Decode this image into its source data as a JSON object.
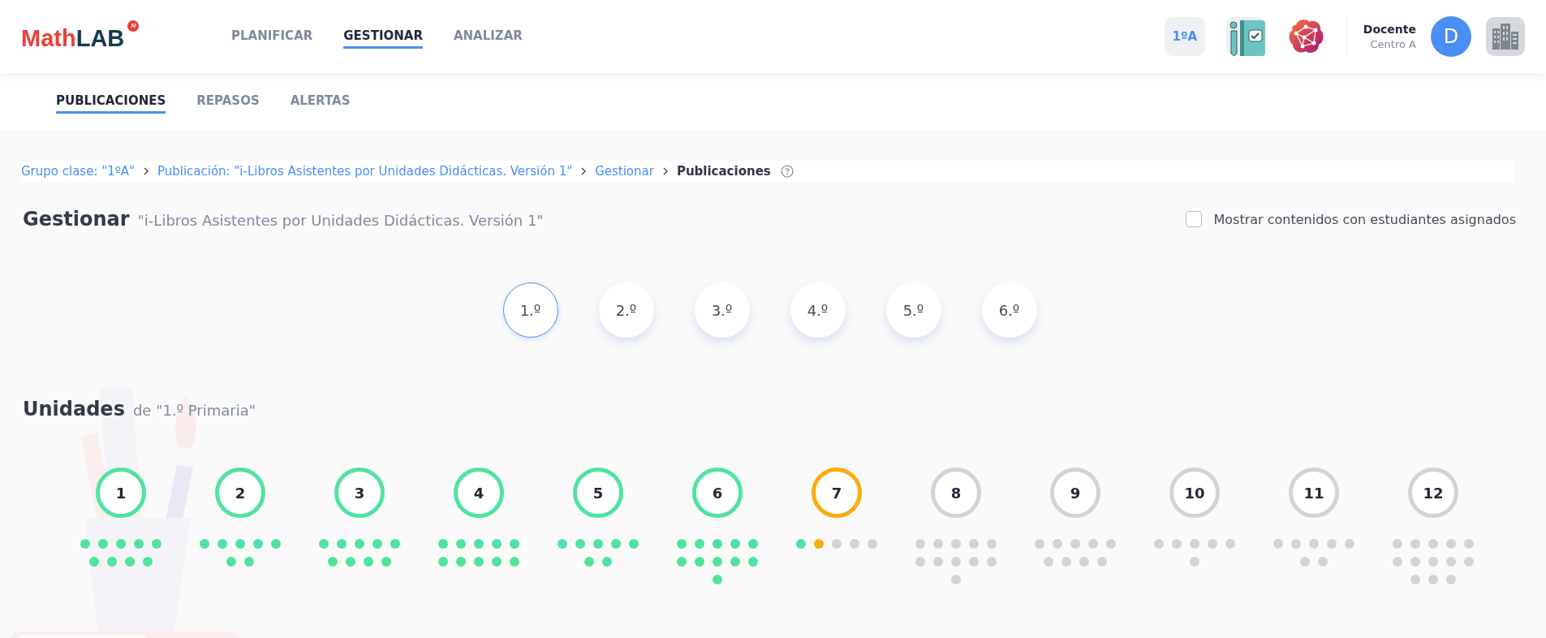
{
  "header": {
    "logo": {
      "part_1": "Math",
      "part_2": "LAB",
      "badge": "N"
    },
    "nav": [
      {
        "label": "PLANIFICAR",
        "selected": false
      },
      {
        "label": "GESTIONAR",
        "selected": true
      },
      {
        "label": "ANALIZAR",
        "selected": false
      }
    ],
    "group_badge": "1ºA",
    "user": {
      "name": "Docente",
      "center": "Centro A",
      "initial": "D"
    }
  },
  "subnav": [
    {
      "label": "PUBLICACIONES",
      "selected": true
    },
    {
      "label": "REPASOS",
      "selected": false
    },
    {
      "label": "ALERTAS",
      "selected": false
    }
  ],
  "breadcrumb": [
    {
      "label": "Grupo clase: \"1ºA\"",
      "current": false
    },
    {
      "label": "Publicación: \"i-Libros Asistentes por Unidades Didácticas. Versión 1\"",
      "current": false
    },
    {
      "label": "Gestionar",
      "current": false
    },
    {
      "label": "Publicaciones",
      "current": true
    }
  ],
  "title": {
    "heading": "Gestionar",
    "subtitle": "\"i-Libros Asistentes por Unidades Didácticas. Versión 1\""
  },
  "filter": {
    "label": "Mostrar contenidos con estudiantes asignados",
    "checked": false
  },
  "grades": [
    {
      "label": "1.º",
      "selected": true
    },
    {
      "label": "2.º",
      "selected": false
    },
    {
      "label": "3.º",
      "selected": false
    },
    {
      "label": "4.º",
      "selected": false
    },
    {
      "label": "5.º",
      "selected": false
    },
    {
      "label": "6.º",
      "selected": false
    }
  ],
  "units_title": {
    "heading": "Unidades",
    "subtitle": "de \"1.º Primaria\""
  },
  "units": [
    {
      "number": "1",
      "done": true,
      "current": false,
      "dots": [
        {
          "done": true,
          "current": false
        },
        {
          "done": true,
          "current": false
        },
        {
          "done": true,
          "current": false
        },
        {
          "done": true,
          "current": false
        },
        {
          "done": true,
          "current": false
        },
        {
          "done": true,
          "current": false
        },
        {
          "done": true,
          "current": false
        },
        {
          "done": true,
          "current": false
        },
        {
          "done": true,
          "current": false
        }
      ]
    },
    {
      "number": "2",
      "done": true,
      "current": false,
      "dots": [
        {
          "done": true,
          "current": false
        },
        {
          "done": true,
          "current": false
        },
        {
          "done": true,
          "current": false
        },
        {
          "done": true,
          "current": false
        },
        {
          "done": true,
          "current": false
        },
        {
          "done": true,
          "current": false
        },
        {
          "done": true,
          "current": false
        }
      ]
    },
    {
      "number": "3",
      "done": true,
      "current": false,
      "dots": [
        {
          "done": true,
          "current": false
        },
        {
          "done": true,
          "current": false
        },
        {
          "done": true,
          "current": false
        },
        {
          "done": true,
          "current": false
        },
        {
          "done": true,
          "current": false
        },
        {
          "done": true,
          "current": false
        },
        {
          "done": true,
          "current": false
        },
        {
          "done": true,
          "current": false
        },
        {
          "done": true,
          "current": false
        }
      ]
    },
    {
      "number": "4",
      "done": true,
      "current": false,
      "dots": [
        {
          "done": true,
          "current": false
        },
        {
          "done": true,
          "current": false
        },
        {
          "done": true,
          "current": false
        },
        {
          "done": true,
          "current": false
        },
        {
          "done": true,
          "current": false
        },
        {
          "done": true,
          "current": false
        },
        {
          "done": true,
          "current": false
        },
        {
          "done": true,
          "current": false
        },
        {
          "done": true,
          "current": false
        },
        {
          "done": true,
          "current": false
        }
      ]
    },
    {
      "number": "5",
      "done": true,
      "current": false,
      "dots": [
        {
          "done": true,
          "current": false
        },
        {
          "done": true,
          "current": false
        },
        {
          "done": true,
          "current": false
        },
        {
          "done": true,
          "current": false
        },
        {
          "done": true,
          "current": false
        },
        {
          "done": true,
          "current": false
        },
        {
          "done": true,
          "current": false
        }
      ]
    },
    {
      "number": "6",
      "done": true,
      "current": false,
      "dots": [
        {
          "done": true,
          "current": false
        },
        {
          "done": true,
          "current": false
        },
        {
          "done": true,
          "current": false
        },
        {
          "done": true,
          "current": false
        },
        {
          "done": true,
          "current": false
        },
        {
          "done": true,
          "current": false
        },
        {
          "done": true,
          "current": false
        },
        {
          "done": true,
          "current": false
        },
        {
          "done": true,
          "current": false
        },
        {
          "done": true,
          "current": false
        },
        {
          "done": true,
          "current": false
        }
      ]
    },
    {
      "number": "7",
      "done": false,
      "current": true,
      "dots": [
        {
          "done": true,
          "current": false
        },
        {
          "done": false,
          "current": true
        },
        {
          "done": false,
          "current": false
        },
        {
          "done": false,
          "current": false
        },
        {
          "done": false,
          "current": false
        }
      ]
    },
    {
      "number": "8",
      "done": false,
      "current": false,
      "dots": [
        {
          "done": false,
          "current": false
        },
        {
          "done": false,
          "current": false
        },
        {
          "done": false,
          "current": false
        },
        {
          "done": false,
          "current": false
        },
        {
          "done": false,
          "current": false
        },
        {
          "done": false,
          "current": false
        },
        {
          "done": false,
          "current": false
        },
        {
          "done": false,
          "current": false
        },
        {
          "done": false,
          "current": false
        },
        {
          "done": false,
          "current": false
        },
        {
          "done": false,
          "current": false
        }
      ]
    },
    {
      "number": "9",
      "done": false,
      "current": false,
      "dots": [
        {
          "done": false,
          "current": false
        },
        {
          "done": false,
          "current": false
        },
        {
          "done": false,
          "current": false
        },
        {
          "done": false,
          "current": false
        },
        {
          "done": false,
          "current": false
        },
        {
          "done": false,
          "current": false
        },
        {
          "done": false,
          "current": false
        },
        {
          "done": false,
          "current": false
        },
        {
          "done": false,
          "current": false
        }
      ]
    },
    {
      "number": "10",
      "done": false,
      "current": false,
      "dots": [
        {
          "done": false,
          "current": false
        },
        {
          "done": false,
          "current": false
        },
        {
          "done": false,
          "current": false
        },
        {
          "done": false,
          "current": false
        },
        {
          "done": false,
          "current": false
        },
        {
          "done": false,
          "current": false
        }
      ]
    },
    {
      "number": "11",
      "done": false,
      "current": false,
      "dots": [
        {
          "done": false,
          "current": false
        },
        {
          "done": false,
          "current": false
        },
        {
          "done": false,
          "current": false
        },
        {
          "done": false,
          "current": false
        },
        {
          "done": false,
          "current": false
        },
        {
          "done": false,
          "current": false
        },
        {
          "done": false,
          "current": false
        }
      ]
    },
    {
      "number": "12",
      "done": false,
      "current": false,
      "dots": [
        {
          "done": false,
          "current": false
        },
        {
          "done": false,
          "current": false
        },
        {
          "done": false,
          "current": false
        },
        {
          "done": false,
          "current": false
        },
        {
          "done": false,
          "current": false
        },
        {
          "done": false,
          "current": false
        },
        {
          "done": false,
          "current": false
        },
        {
          "done": false,
          "current": false
        },
        {
          "done": false,
          "current": false
        },
        {
          "done": false,
          "current": false
        },
        {
          "done": false,
          "current": false
        },
        {
          "done": false,
          "current": false
        },
        {
          "done": false,
          "current": false
        }
      ]
    }
  ]
}
